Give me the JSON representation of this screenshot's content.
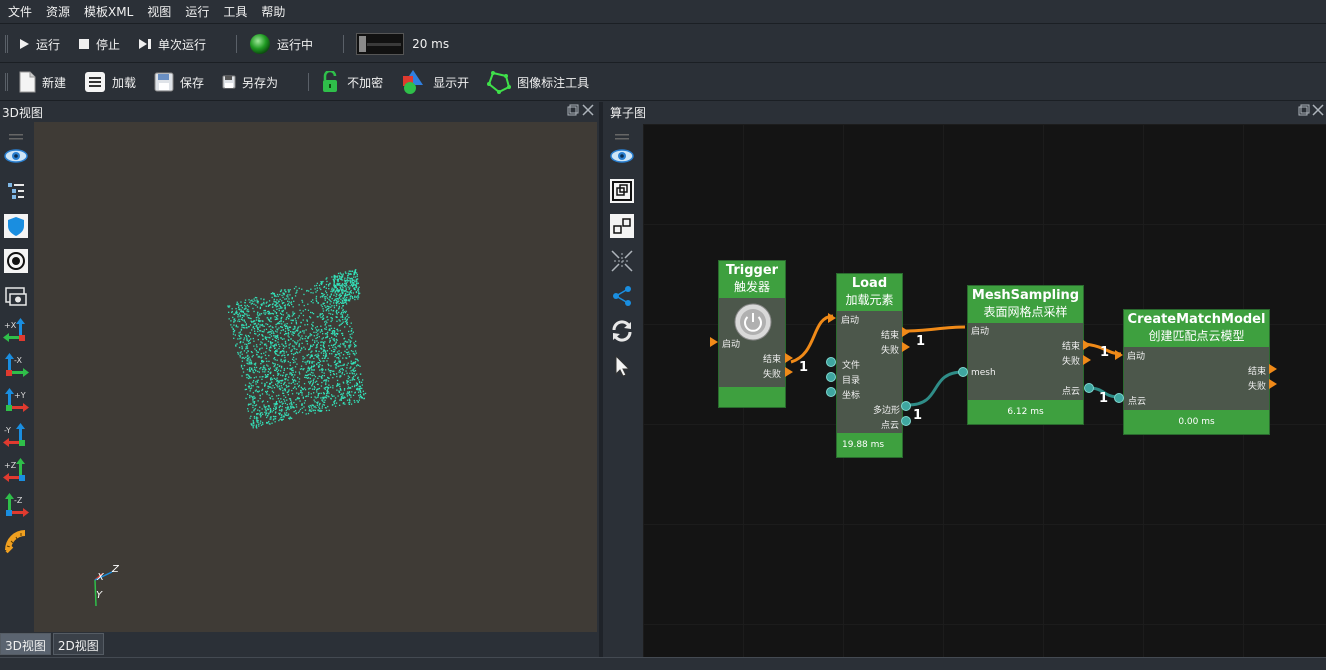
{
  "menu": [
    "文件",
    "资源",
    "模板XML",
    "视图",
    "运行",
    "工具",
    "帮助"
  ],
  "toolbar1": {
    "run": "运行",
    "stop": "停止",
    "single_run": "单次运行",
    "status": "运行中",
    "interval": "20 ms"
  },
  "toolbar2": {
    "new": "新建",
    "load": "加载",
    "save": "保存",
    "save_as": "另存为",
    "encrypt": "不加密",
    "display": "显示开",
    "annotate": "图像标注工具"
  },
  "left_panel": {
    "title": "3D视图",
    "axis_labels": {
      "x": "X",
      "y": "Y",
      "z": "Z"
    },
    "tabs": [
      "3D视图",
      "2D视图"
    ],
    "sidebar_icons": [
      {
        "name": "eye-icon"
      },
      {
        "name": "tree-list-icon"
      },
      {
        "name": "shield-icon"
      },
      {
        "name": "target-icon"
      },
      {
        "name": "camera-frame-icon"
      },
      {
        "name": "view-plus-x-icon",
        "label": "+X"
      },
      {
        "name": "view-minus-x-icon",
        "label": "-X"
      },
      {
        "name": "view-plus-y-icon",
        "label": "+Y"
      },
      {
        "name": "view-minus-y-icon",
        "label": "-Y"
      },
      {
        "name": "view-plus-z-icon",
        "label": "+Z"
      },
      {
        "name": "view-minus-z-icon",
        "label": "-Z"
      },
      {
        "name": "ruler-protractor-icon"
      }
    ]
  },
  "right_panel": {
    "title": "算子图",
    "nodes": {
      "trigger": {
        "name": "Trigger",
        "label": "触发器",
        "in_start": "启动",
        "out_end": "结束",
        "out_fail": "失败"
      },
      "load": {
        "name": "Load",
        "label": "加载元素",
        "in_start": "启动",
        "in_file": "文件",
        "in_dir": "目录",
        "in_coord": "坐标",
        "out_end": "结束",
        "out_fail": "失败",
        "out_polygon": "多边形",
        "out_cloud": "点云",
        "time": "19.88 ms"
      },
      "mesh": {
        "name": "MeshSampling",
        "label": "表面网格点采样",
        "in_start": "启动",
        "in_mesh": "mesh",
        "out_end": "结束",
        "out_fail": "失败",
        "out_cloud": "点云",
        "time": "6.12 ms"
      },
      "cmm": {
        "name": "CreateMatchModel",
        "label": "创建匹配点云模型",
        "in_start": "启动",
        "in_cloud": "点云",
        "out_end": "结束",
        "out_fail": "失败",
        "time": "0.00 ms"
      }
    },
    "connection_counts": [
      "1",
      "1",
      "1",
      "1",
      "1"
    ]
  },
  "colors": {
    "accent_green": "#3ea03f",
    "flow_orange": "#f08a18",
    "data_teal": "#2f8d88",
    "point_cloud": "#34e0b8"
  }
}
